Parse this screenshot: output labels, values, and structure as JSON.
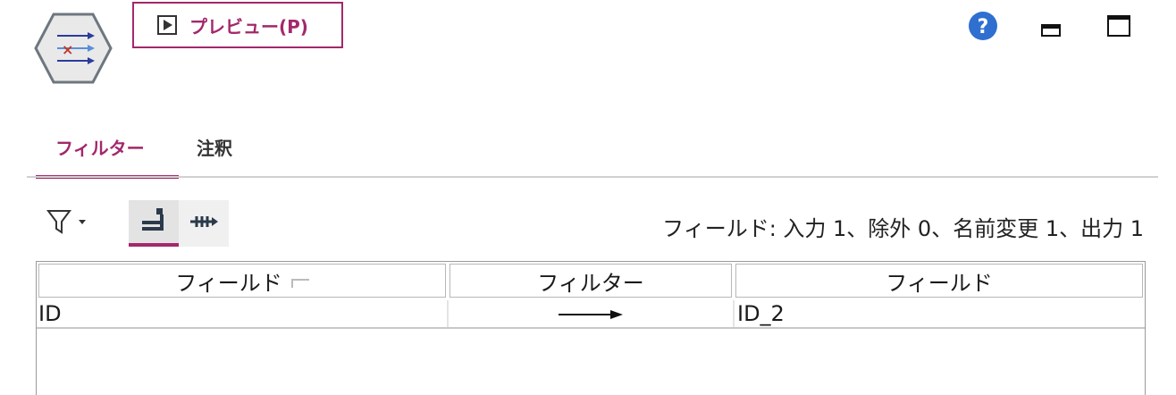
{
  "toolbar": {
    "preview_label": "プレビュー(P)",
    "icons": [
      "filter-node-icon",
      "play-icon",
      "help-icon",
      "minimize-icon",
      "maximize-icon"
    ]
  },
  "tabs": [
    {
      "label": "フィルター",
      "selected": true
    },
    {
      "label": "注釈",
      "selected": false
    }
  ],
  "filter_toolbar": {
    "icons": [
      "funnel-dropdown-icon",
      "pass-fields-icon",
      "discard-fields-icon"
    ],
    "summary": "フィールド: 入力 1、除外 0、名前変更 1、出力 1"
  },
  "table": {
    "headers": [
      "フィールド",
      "フィルター",
      "フィールド"
    ],
    "rows": [
      {
        "input": "ID",
        "filter": "arrow-right-icon",
        "output": "ID_2"
      }
    ]
  },
  "colors": {
    "accent": "#a3286b",
    "help": "#2f6fd0",
    "divider": "#d0d0d0"
  }
}
